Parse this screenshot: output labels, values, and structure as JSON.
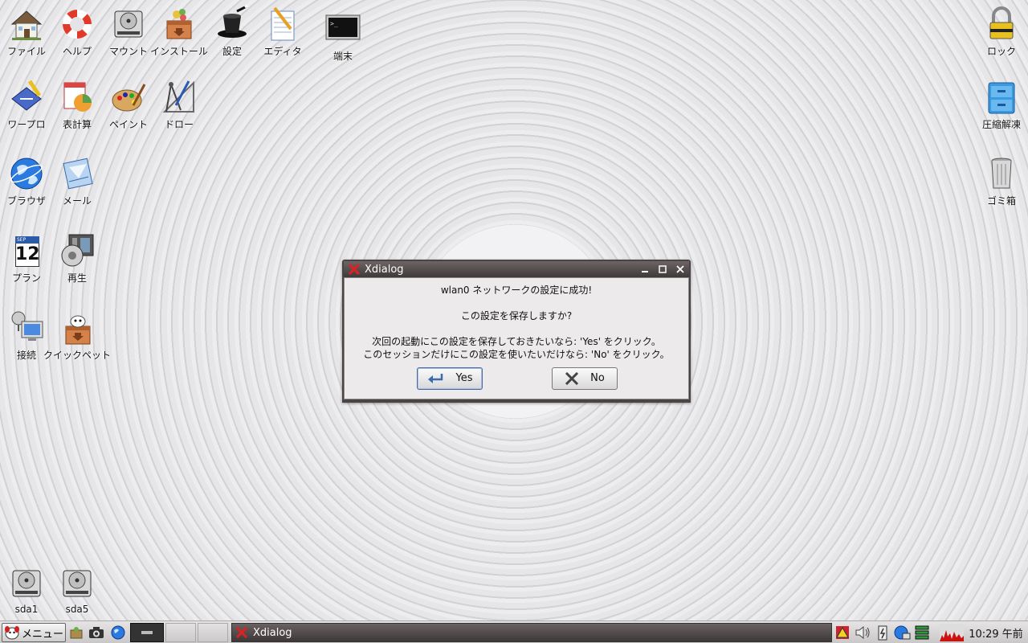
{
  "desktop": {
    "icons_left": [
      {
        "label": "ファイル",
        "icon": "home-icon"
      },
      {
        "label": "ヘルプ",
        "icon": "lifebuoy-icon"
      },
      {
        "label": "マウント",
        "icon": "harddrive-icon"
      },
      {
        "label": "インストール",
        "icon": "install-box-icon"
      },
      {
        "label": "設定",
        "icon": "magic-hat-icon"
      },
      {
        "label": "エディタ",
        "icon": "notepad-icon"
      },
      {
        "label": "端末",
        "icon": "terminal-icon"
      },
      {
        "label": "ワープロ",
        "icon": "wordprocessor-icon"
      },
      {
        "label": "表計算",
        "icon": "spreadsheet-icon"
      },
      {
        "label": "ペイント",
        "icon": "palette-icon"
      },
      {
        "label": "ドロー",
        "icon": "draw-compass-icon"
      },
      {
        "label": "ブラウザ",
        "icon": "globe-icon"
      },
      {
        "label": "メール",
        "icon": "mail-icon"
      },
      {
        "label": "プラン",
        "icon": "calendar-icon"
      },
      {
        "label": "再生",
        "icon": "media-player-icon"
      },
      {
        "label": "接続",
        "icon": "network-connect-icon"
      },
      {
        "label": "クイックペット",
        "icon": "quickpet-icon"
      }
    ],
    "calendar": {
      "month": "SEP",
      "day": "12"
    },
    "icons_right": [
      {
        "label": "ロック",
        "icon": "padlock-icon"
      },
      {
        "label": "圧縮解凍",
        "icon": "archive-cabinet-icon"
      },
      {
        "label": "ゴミ箱",
        "icon": "trash-icon"
      }
    ],
    "drives": [
      {
        "label": "sda1",
        "icon": "drive-icon"
      },
      {
        "label": "sda5",
        "icon": "drive-icon"
      }
    ]
  },
  "dialog": {
    "title": "Xdialog",
    "line1": "wlan0 ネットワークの設定に成功!",
    "line2": "この設定を保存しますか?",
    "line3": "次回の起動にこの設定を保存しておきたいなら: 'Yes' をクリック。",
    "line4": "このセッションだけにこの設定を使いたいだけなら: 'No' をクリック。",
    "yes_label": "Yes",
    "no_label": "No"
  },
  "taskbar": {
    "menu_label": "メニュー",
    "task_label": "Xdialog",
    "clock": "10:29 午前"
  },
  "colors": {
    "title_bar": "#4a4444",
    "dialog_bg": "#eceaea",
    "accent_red": "#cc1111"
  }
}
